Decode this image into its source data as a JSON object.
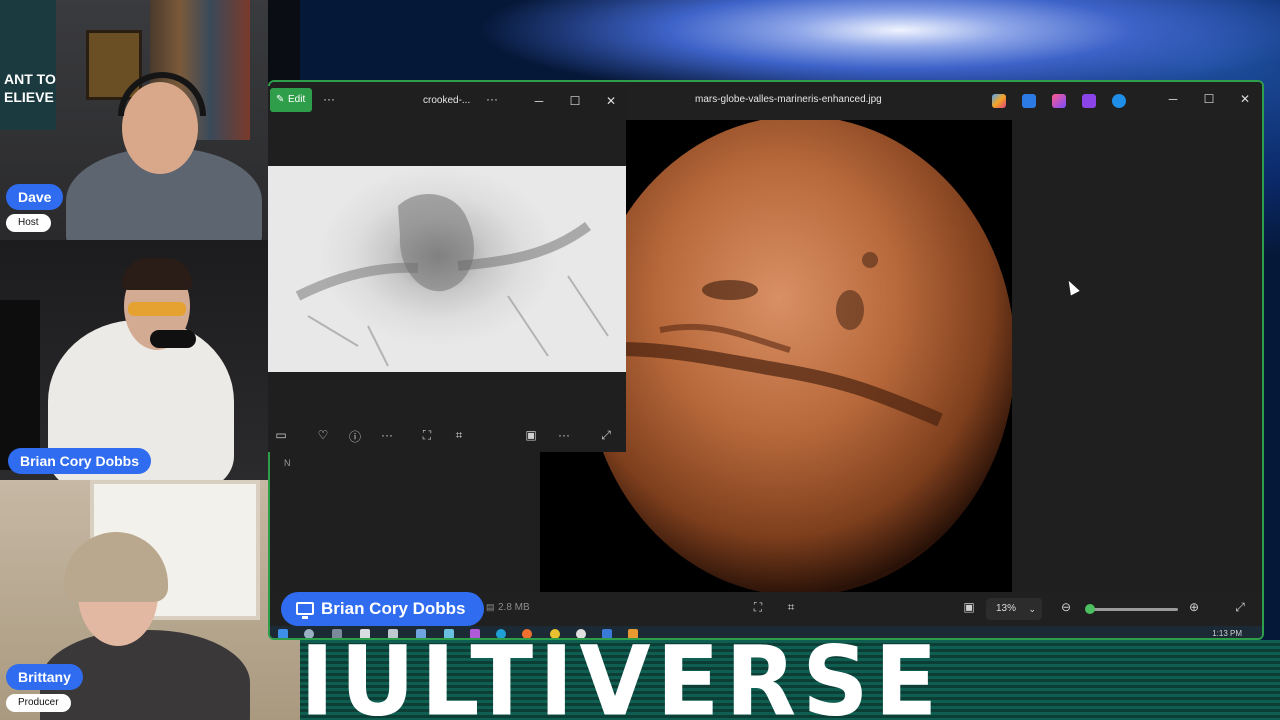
{
  "participants": [
    {
      "name": "Dave",
      "role": "Host"
    },
    {
      "name": "Brian Cory Dobbs",
      "role": ""
    },
    {
      "name": "Brittany",
      "role": "Producer"
    }
  ],
  "background": {
    "poster_text": "ANT TO\nELIEVE",
    "banner_text": "IULTIVERSE"
  },
  "main_window": {
    "title": "mars-globe-valles-marineris-enhanced.jpg",
    "file_size": "2.8 MB",
    "zoom": "13%",
    "zoom_level_percent": 0,
    "side_label": "N",
    "clock": "1:13 PM",
    "controls": {
      "minimize": "─",
      "maximize": "☐",
      "close": "✕"
    }
  },
  "sub_window": {
    "edit_label": "Edit",
    "title": "crooked-...",
    "more": "···",
    "controls": {
      "minimize": "─",
      "maximize": "☐",
      "close": "✕"
    }
  },
  "caption": {
    "text": "Brian Cory Dobbs"
  },
  "colors": {
    "accent_blue": "#2f6cf0",
    "edit_green": "#2f9e4b",
    "mars": "#b86a3c"
  }
}
